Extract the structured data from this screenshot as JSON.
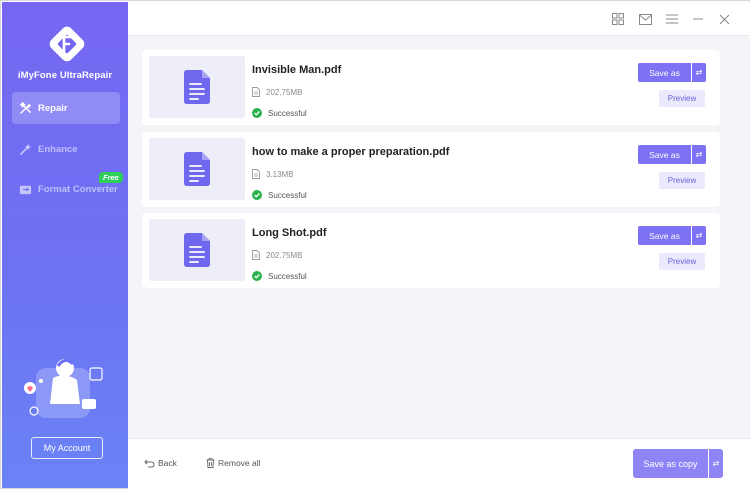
{
  "app": {
    "brand": "iMyFone UltraRepair"
  },
  "sidebar": {
    "items": [
      {
        "label": "Repair",
        "icon": "repair-tools-icon",
        "active": true
      },
      {
        "label": "Enhance",
        "icon": "enhance-wand-icon",
        "active": false
      },
      {
        "label": "Format Converter",
        "icon": "format-converter-icon",
        "active": false,
        "badge": "Free"
      }
    ],
    "account_label": "My Account"
  },
  "topbar": {
    "icons": [
      "grid-icon",
      "mail-icon",
      "menu-icon",
      "minimize-icon",
      "close-icon"
    ]
  },
  "files": [
    {
      "name": "Invisible Man.pdf",
      "size": "202.75MB",
      "status": "Successful"
    },
    {
      "name": "how to make a proper preparation.pdf",
      "size": "3.13MB",
      "status": "Successful"
    },
    {
      "name": "Long Shot.pdf",
      "size": "202.75MB",
      "status": "Successful"
    }
  ],
  "file_actions": {
    "save_as": "Save as",
    "swap": "⇄",
    "preview": "Preview"
  },
  "bottom": {
    "back": "Back",
    "remove_all": "Remove all",
    "save_as_copy": "Save as copy",
    "swap": "⇄"
  },
  "colors": {
    "accent": "#7d72f3",
    "success": "#2bb24c",
    "free_badge": "#2dcf5a"
  }
}
